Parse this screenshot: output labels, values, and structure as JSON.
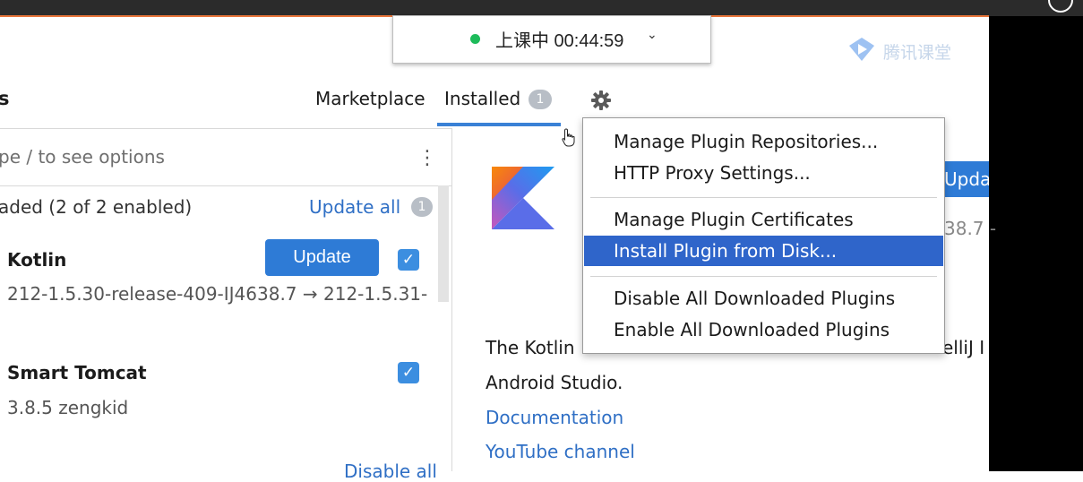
{
  "session": {
    "status_text": "上课中 00:44:59",
    "status_color": "#1dbb5a"
  },
  "brand": {
    "name": "腾讯课堂"
  },
  "header": {
    "title_fragment": "s"
  },
  "tabs": [
    {
      "label": "Marketplace"
    },
    {
      "label": "Installed",
      "badge": "1"
    }
  ],
  "search": {
    "placeholder_fragment": "pe / to see options"
  },
  "group": {
    "label": "aded (2 of 2 enabled)",
    "action": "Update all",
    "badge": "1"
  },
  "plugins": [
    {
      "name": "Kotlin",
      "meta": "212-1.5.30-release-409-IJ4638.7 → 212-1.5.31-",
      "button": "Update",
      "checked": true
    },
    {
      "name": "Smart Tomcat",
      "meta": "3.8.5  zengkid",
      "checked": true
    }
  ],
  "footer_link": "Disable all",
  "detail": {
    "update_button": "Upda",
    "version_fragment": "38.7 -",
    "description_start": "The Kotlin",
    "description_tail": "elliJ I",
    "description_line2": "Android Studio.",
    "links": [
      "Documentation",
      "YouTube channel"
    ]
  },
  "menu": {
    "items": [
      {
        "label": "Manage Plugin Repositories..."
      },
      {
        "label": "HTTP Proxy Settings..."
      },
      {
        "label": "Manage Plugin Certificates"
      },
      {
        "label": "Install Plugin from Disk...",
        "selected": true
      },
      {
        "label": "Disable All Downloaded Plugins"
      },
      {
        "label": "Enable All Downloaded Plugins"
      }
    ]
  },
  "colors": {
    "accent": "#2e7bd6",
    "link": "#2f6fc5",
    "menu_selection": "#2f65ca"
  }
}
